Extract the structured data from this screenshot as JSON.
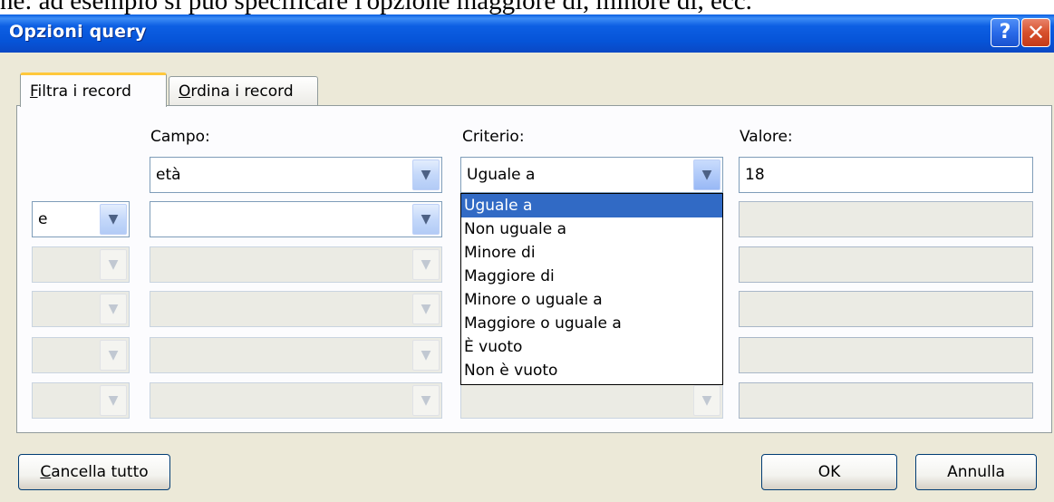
{
  "document_text": "ne: ad esempio si può specificare l'opzione maggiore di, minore di, ecc.",
  "dialog": {
    "title": "Opzioni query",
    "help_label": "?",
    "close_label": "✕"
  },
  "tabs": [
    {
      "prefix": "",
      "accel": "F",
      "rest": "iltra i record"
    },
    {
      "prefix": "",
      "accel": "O",
      "rest": "rdina i record"
    }
  ],
  "columns": {
    "campo": "Campo:",
    "criterio": "Criterio:",
    "valore": "Valore:"
  },
  "rows": [
    {
      "connector": "",
      "field": "età",
      "criterion": "Uguale a",
      "value": "18"
    },
    {
      "connector": "e",
      "field": "",
      "criterion": "",
      "value": ""
    }
  ],
  "criteria_options": [
    "Uguale a",
    "Non uguale a",
    "Minore di",
    "Maggiore di",
    "Minore o uguale a",
    "Maggiore o uguale a",
    "È vuoto",
    "Non è vuoto"
  ],
  "selected_option_index": 0,
  "buttons": {
    "clear": {
      "accel": "C",
      "rest": "ancella tutto"
    },
    "ok": "OK",
    "cancel": "Annulla"
  },
  "icons": {
    "dropdown": "chevron-down-icon",
    "help": "help-icon",
    "close": "close-icon"
  }
}
